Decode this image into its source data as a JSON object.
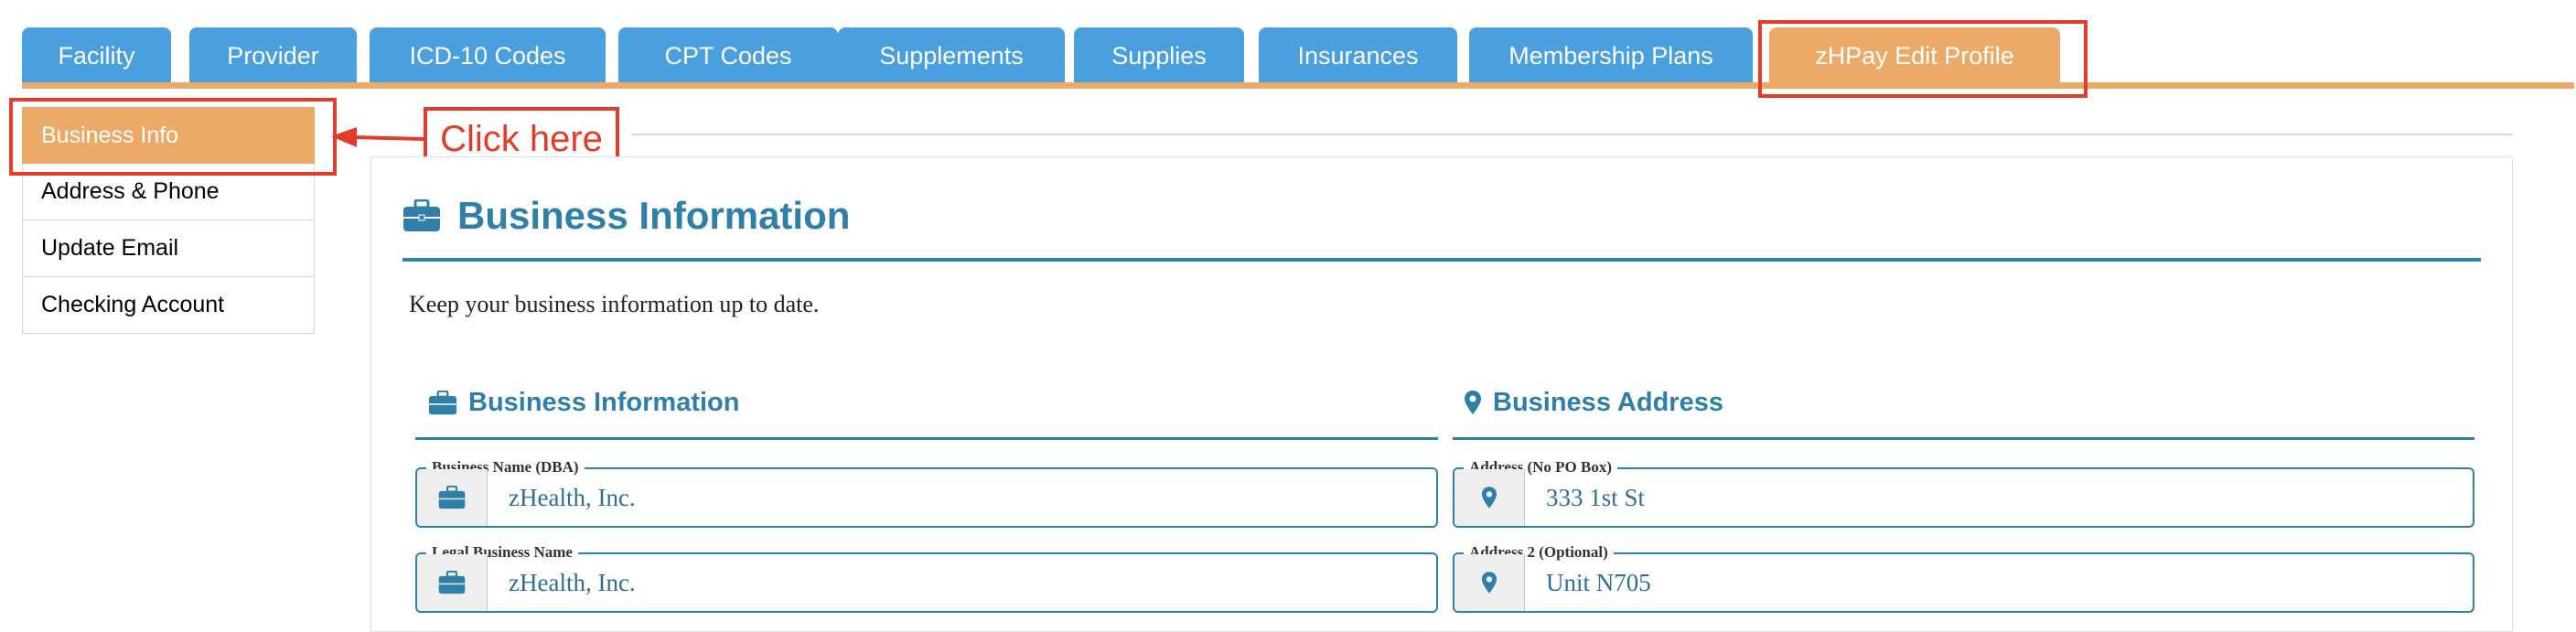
{
  "tabs": [
    {
      "label": "Facility"
    },
    {
      "label": "Provider"
    },
    {
      "label": "ICD-10 Codes"
    },
    {
      "label": "CPT Codes"
    },
    {
      "label": "Supplements"
    },
    {
      "label": "Supplies"
    },
    {
      "label": "Insurances"
    },
    {
      "label": "Membership Plans"
    },
    {
      "label": "zHPay Edit Profile",
      "active": true
    }
  ],
  "sidebar": {
    "items": [
      {
        "label": "Business Info",
        "active": true
      },
      {
        "label": "Address & Phone"
      },
      {
        "label": "Update Email"
      },
      {
        "label": "Checking Account"
      }
    ]
  },
  "annotation": {
    "text": "Click here"
  },
  "main": {
    "title": "Business Information",
    "description": "Keep your business information up to date.",
    "business_info": {
      "title": "Business Information",
      "fields": [
        {
          "label": "Business Name (DBA)",
          "value": "zHealth, Inc."
        },
        {
          "label": "Legal Business Name",
          "value": "zHealth, Inc."
        }
      ]
    },
    "business_address": {
      "title": "Business Address",
      "fields": [
        {
          "label": "Address (No PO Box)",
          "value": "333 1st St"
        },
        {
          "label": "Address 2 (Optional)",
          "value": "Unit N705"
        }
      ]
    }
  },
  "colors": {
    "tab": "#4a9fde",
    "active": "#ecaa68",
    "accent": "#2f7fa8",
    "highlight": "#e23c2b"
  }
}
